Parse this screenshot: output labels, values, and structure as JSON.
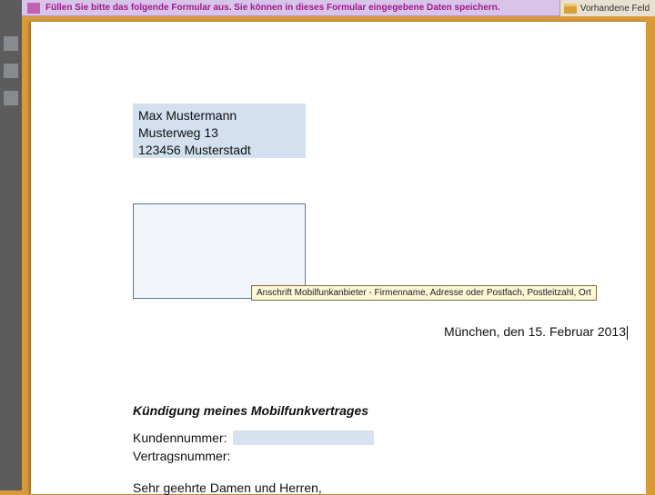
{
  "topbar": {
    "instruction": "Füllen Sie bitte das folgende Formular aus. Sie können in dieses Formular eingegebene Daten speichern.",
    "highlight_button": "Vorhandene Feld"
  },
  "document": {
    "sender": {
      "name": "Max Mustermann",
      "street": "Musterweg 13",
      "city": "123456 Musterstadt"
    },
    "recipient_tooltip": "Anschrift Mobilfunkanbieter - Firmenname, Adresse oder Postfach, Postleitzahl, Ort",
    "date_line": "München, den 15. Februar 2013",
    "subject": "Kündigung meines Mobilfunkvertrages",
    "fields": {
      "customer_label": "Kundennummer:",
      "contract_label": "Vertragsnummer:"
    },
    "salutation": "Sehr geehrte Damen und Herren,"
  }
}
